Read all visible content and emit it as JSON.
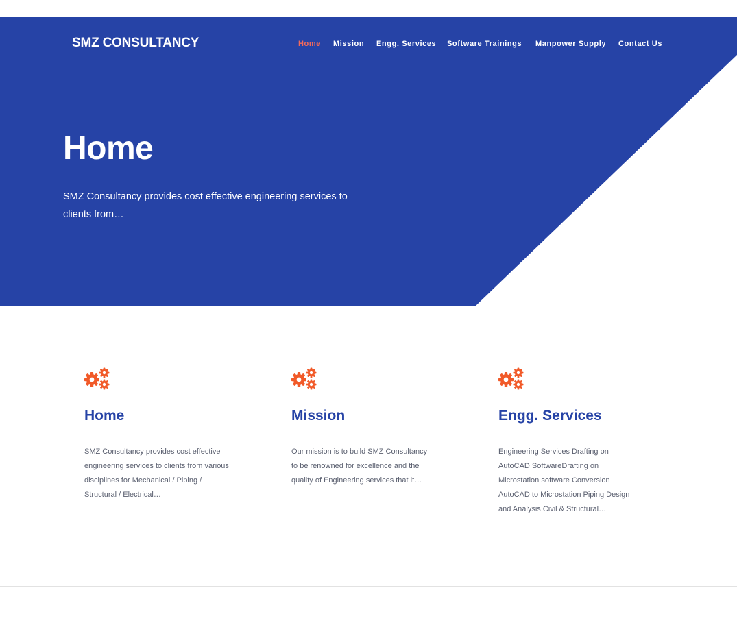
{
  "site": {
    "brand": "SMZ CONSULTANCY"
  },
  "nav": {
    "items": [
      {
        "label": "Home",
        "active": true
      },
      {
        "label": "Mission",
        "active": false
      },
      {
        "label": "Engg. Services",
        "active": false
      },
      {
        "label": "Software Trainings",
        "active": false
      },
      {
        "label": "Manpower Supply",
        "active": false
      },
      {
        "label": "Contact Us",
        "active": false
      }
    ]
  },
  "hero": {
    "title": "Home",
    "text": "SMZ Consultancy provides cost effective engineering services to clients from…"
  },
  "cards": [
    {
      "icon": "gears-icon",
      "title": "Home",
      "text": "SMZ Consultancy provides cost effective engineering services to clients from various disciplines for Mechanical / Piping / Structural / Electrical…"
    },
    {
      "icon": "gears-icon",
      "title": "Mission",
      "text": "Our mission is to build SMZ Consultancy to be renowned for excellence and the quality of Engineering services that it…"
    },
    {
      "icon": "gears-icon",
      "title": "Engg. Services",
      "text": "Engineering Services Drafting on AutoCAD SoftwareDrafting on Microstation software Conversion AutoCAD to Microstation Piping Design and Analysis Civil & Structural…"
    }
  ],
  "colors": {
    "primary": "#2643a6",
    "accent": "#f15a29",
    "nav_active": "#f26a5b",
    "body_text": "#5b6070"
  }
}
